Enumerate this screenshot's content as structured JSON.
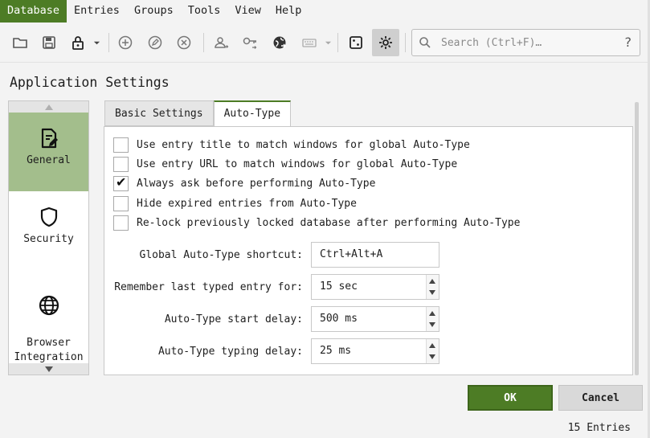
{
  "menu": {
    "items": [
      "Database",
      "Entries",
      "Groups",
      "Tools",
      "View",
      "Help"
    ],
    "active_index": 0
  },
  "toolbar": {
    "icons": [
      "folder-open-icon",
      "save-icon",
      "lock-icon",
      "chevron-down-icon",
      "add-entry-icon",
      "edit-entry-icon",
      "delete-entry-icon",
      "copy-username-icon",
      "copy-password-icon",
      "open-url-icon",
      "keyboard-icon",
      "chevron-down-icon",
      "password-generator-icon",
      "settings-icon"
    ],
    "search_placeholder": "Search (Ctrl+F)…",
    "search_help": "?"
  },
  "page": {
    "title": "Application Settings"
  },
  "categories": [
    {
      "label": "General",
      "icon": "document-edit-icon",
      "selected": true
    },
    {
      "label": "Security",
      "icon": "shield-icon",
      "selected": false
    },
    {
      "label": "Browser\nIntegration",
      "icon": "globe-icon",
      "selected": false
    }
  ],
  "tabs": [
    {
      "label": "Basic Settings",
      "active": false
    },
    {
      "label": "Auto-Type",
      "active": true
    }
  ],
  "checkboxes": [
    {
      "label": "Use entry title to match windows for global Auto-Type",
      "checked": false
    },
    {
      "label": "Use entry URL to match windows for global Auto-Type",
      "checked": false
    },
    {
      "label": "Always ask before performing Auto-Type",
      "checked": true
    },
    {
      "label": "Hide expired entries from Auto-Type",
      "checked": false
    },
    {
      "label": "Re-lock previously locked database after performing Auto-Type",
      "checked": false
    }
  ],
  "fields": [
    {
      "label": "Global Auto-Type shortcut:",
      "value": "Ctrl+Alt+A",
      "spin": false
    },
    {
      "label": "Remember last typed entry for:",
      "value": "15 sec",
      "spin": true
    },
    {
      "label": "Auto-Type start delay:",
      "value": "500 ms",
      "spin": true
    },
    {
      "label": "Auto-Type typing delay:",
      "value": "25 ms",
      "spin": true
    }
  ],
  "buttons": {
    "ok": "OK",
    "cancel": "Cancel"
  },
  "status": {
    "entries": "15 Entries"
  },
  "colors": {
    "accent": "#4d7c25",
    "selected_category": "#a3be8c"
  }
}
